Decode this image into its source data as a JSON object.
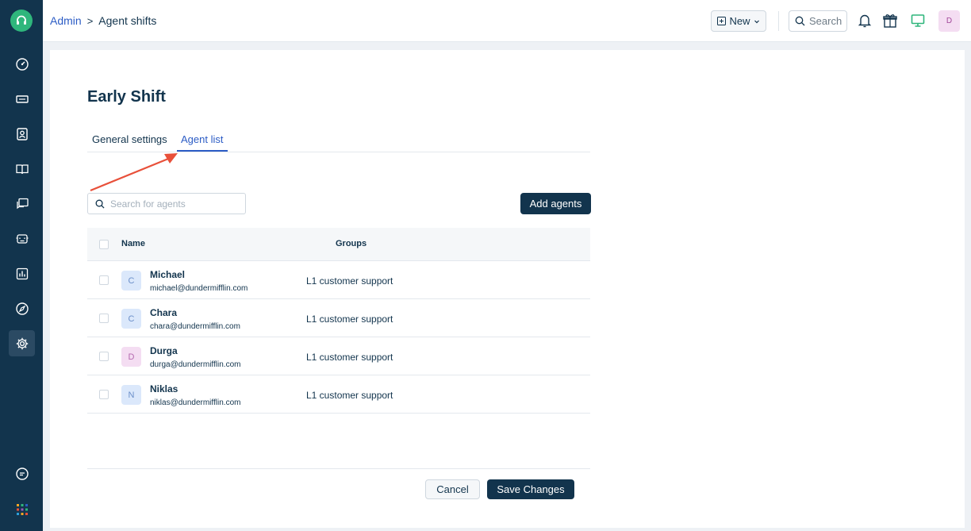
{
  "colors": {
    "sidebar": "#12344d",
    "accent": "#2c5cc5",
    "primary_button": "#12344d",
    "logo": "#2fb67c",
    "annotation_arrow": "#e8503a"
  },
  "sidebar": {
    "logo": "headset-icon",
    "items": [
      {
        "icon": "dashboard-icon"
      },
      {
        "icon": "ticket-icon"
      },
      {
        "icon": "contacts-icon"
      },
      {
        "icon": "book-icon"
      },
      {
        "icon": "chat-icon"
      },
      {
        "icon": "bot-icon"
      },
      {
        "icon": "analytics-icon"
      },
      {
        "icon": "compass-icon"
      },
      {
        "icon": "gear-icon",
        "active": true
      }
    ],
    "bottom": [
      {
        "icon": "message-icon"
      },
      {
        "icon": "apps-grid-icon"
      }
    ]
  },
  "header": {
    "breadcrumb_root": "Admin",
    "breadcrumb_sep": ">",
    "breadcrumb_current": "Agent shifts",
    "new_label": "New",
    "search_label": "Search",
    "avatar_initial": "D"
  },
  "page": {
    "title": "Early Shift",
    "tabs": [
      {
        "label": "General settings"
      },
      {
        "label": "Agent list",
        "active": true
      }
    ],
    "search_placeholder": "Search for agents",
    "add_agents_label": "Add agents",
    "columns": {
      "name": "Name",
      "groups": "Groups"
    },
    "agents": [
      {
        "initial": "C",
        "name": "Michael",
        "email": "michael@dundermifflin.com",
        "group": "L1 customer support",
        "avatar_bg": "#dbe8fb",
        "avatar_fg": "#6b8fc9"
      },
      {
        "initial": "C",
        "name": "Chara",
        "email": "chara@dundermifflin.com",
        "group": "L1 customer support",
        "avatar_bg": "#dbe8fb",
        "avatar_fg": "#6b8fc9"
      },
      {
        "initial": "D",
        "name": "Durga",
        "email": "durga@dundermifflin.com",
        "group": "L1 customer support",
        "avatar_bg": "#f4ddf2",
        "avatar_fg": "#b56aaf"
      },
      {
        "initial": "N",
        "name": "Niklas",
        "email": "niklas@dundermifflin.com",
        "group": "L1 customer support",
        "avatar_bg": "#dbe8fb",
        "avatar_fg": "#6b8fc9"
      }
    ],
    "cancel_label": "Cancel",
    "save_label": "Save Changes"
  }
}
